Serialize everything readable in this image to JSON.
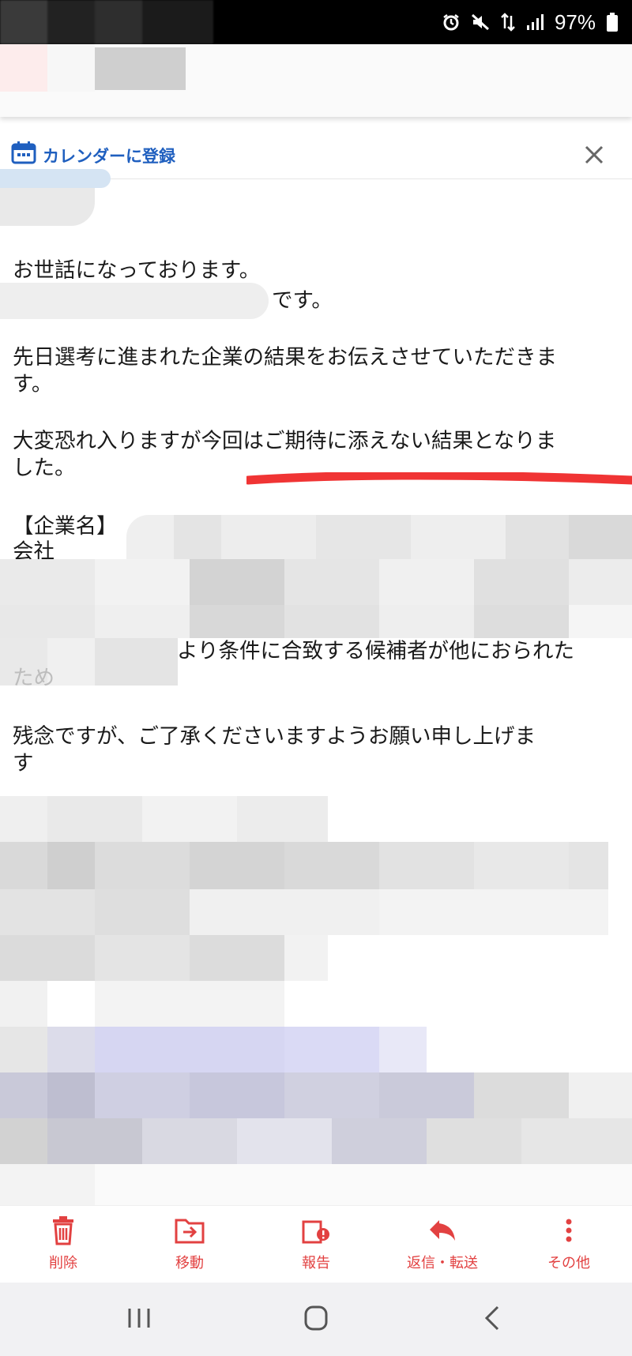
{
  "status_bar": {
    "battery": "97%",
    "icons": [
      "alarm-icon",
      "mute-icon",
      "data-icon",
      "signal-icon",
      "battery-icon"
    ]
  },
  "calendar_bar": {
    "label": "カレンダーに登録",
    "icon": "calendar-icon",
    "close_icon": "close-icon"
  },
  "email": {
    "line1": "お世話になっております。",
    "line2": "です。",
    "line3": "先日選考に進まれた企業の結果をお伝えさせていただきま",
    "line4": "す。",
    "line5": "大変恐れ入りますが今回はご期待に添えない結果となりま",
    "line6": "した。",
    "line7": "【企業名】",
    "line8": "会社",
    "line9": "より条件に合致する候補者が他におられた",
    "line10": "ため",
    "line11": "残念ですが、ご了承くださいますようお願い申し上げま",
    "line12": "す"
  },
  "toolbar": {
    "items": [
      {
        "label": "削除",
        "icon": "trash-icon"
      },
      {
        "label": "移動",
        "icon": "move-folder-icon"
      },
      {
        "label": "報告",
        "icon": "report-icon"
      },
      {
        "label": "返信・転送",
        "icon": "reply-icon"
      },
      {
        "label": "その他",
        "icon": "more-vertical-icon"
      }
    ]
  },
  "navbar": {
    "items": [
      "recent-apps-icon",
      "home-icon",
      "back-icon"
    ]
  },
  "colors": {
    "accent_blue": "#1f5fbf",
    "toolbar_red": "#e24141",
    "underline_red": "#f03434"
  }
}
